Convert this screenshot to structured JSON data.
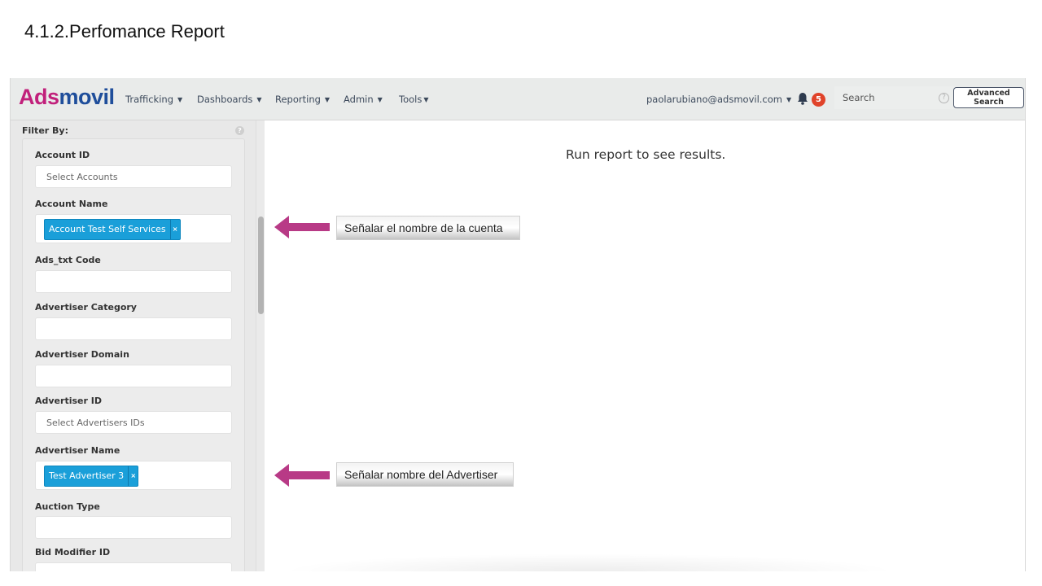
{
  "doc_title": "4.1.2.Perfomance Report",
  "app": {
    "logo": {
      "part1": "Ads",
      "part2": "movil"
    },
    "nav": [
      {
        "label": "Trafficking"
      },
      {
        "label": "Dashboards"
      },
      {
        "label": "Reporting"
      },
      {
        "label": "Admin"
      },
      {
        "label": "Tools"
      }
    ],
    "user_email": "paolarubiano@adsmovil.com",
    "notifications_count": "5",
    "search_placeholder": "Search",
    "help_icon": "?",
    "advanced_search_label": "Advanced Search"
  },
  "sidebar": {
    "title": "Filter By:",
    "filters": [
      {
        "label": "Account ID",
        "placeholder": "Select Accounts"
      },
      {
        "label": "Account Name",
        "tag": "Account Test Self Services",
        "tag_remove": "×"
      },
      {
        "label": "Ads_txt Code"
      },
      {
        "label": "Advertiser Category"
      },
      {
        "label": "Advertiser Domain"
      },
      {
        "label": "Advertiser ID",
        "placeholder": "Select Advertisers IDs"
      },
      {
        "label": "Advertiser Name",
        "tag": "Test Advertiser 3",
        "tag_remove": "×"
      },
      {
        "label": "Auction Type"
      },
      {
        "label": "Bid Modifier ID"
      }
    ]
  },
  "main": {
    "empty_message": "Run report to see results."
  },
  "annotations": [
    {
      "text": "Señalar el nombre de la cuenta",
      "arrow_color": "#b83a86"
    },
    {
      "text": "Señalar nombre del Advertiser",
      "arrow_color": "#b83a86"
    }
  ],
  "colors": {
    "logo_pink": "#c1207b",
    "logo_blue": "#1f4e9b",
    "tag_blue": "#1a9fd9",
    "badge_red": "#e0432a",
    "arrow_magenta": "#b83a86"
  }
}
